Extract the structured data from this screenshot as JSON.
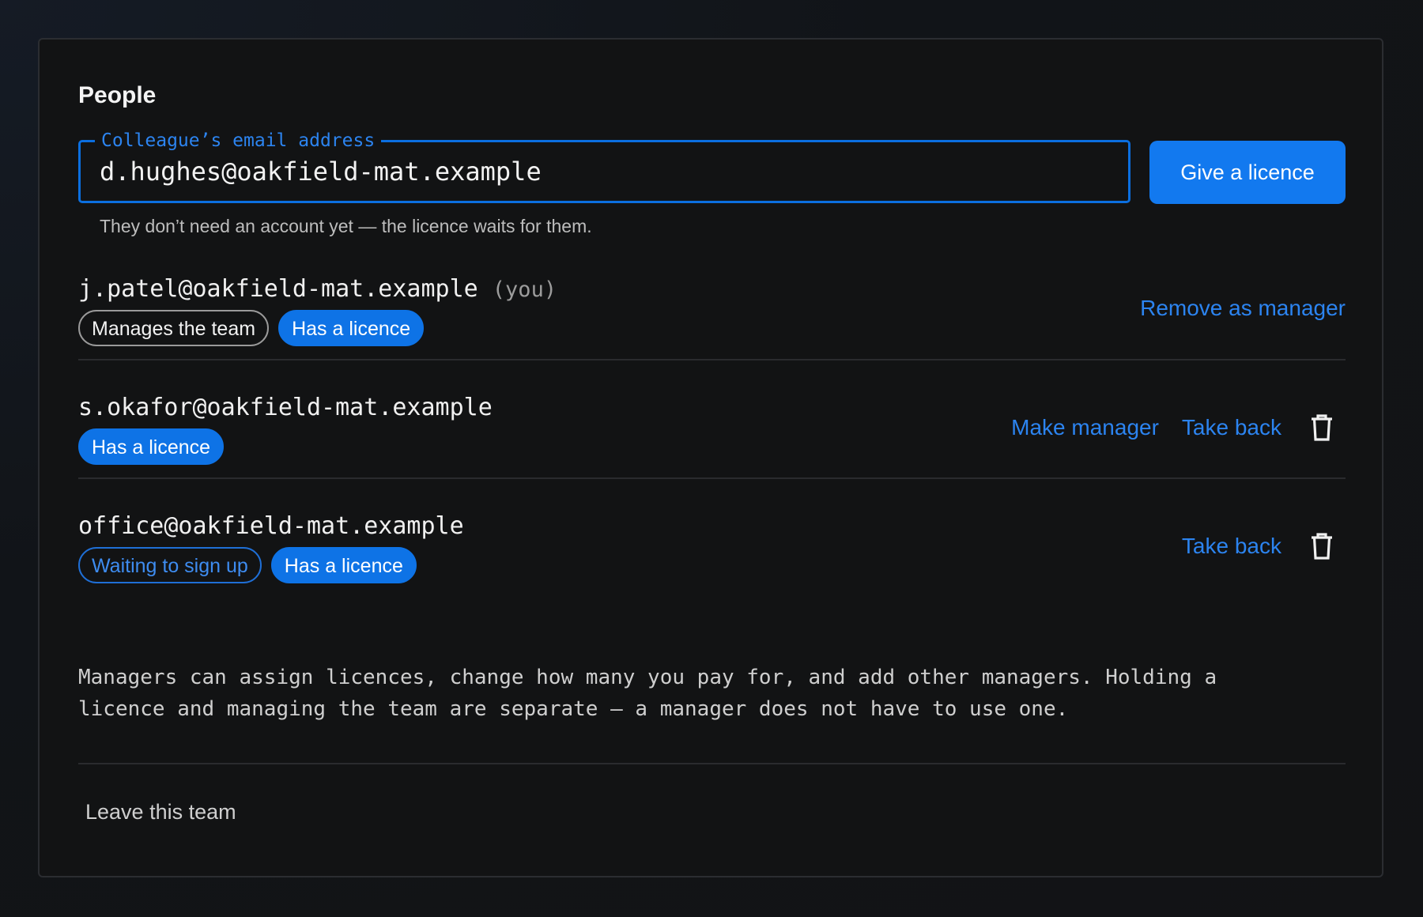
{
  "section_title": "People",
  "invite": {
    "field_label": "Colleague’s email address",
    "value": "d.hughes@oakfield-mat.example",
    "button_label": "Give a licence",
    "hint": "They don’t need an account yet — the licence waits for them."
  },
  "members": [
    {
      "email": "j.patel@oakfield-mat.example",
      "you_label": "(you)",
      "badges": [
        "Manages the team",
        "Has a licence"
      ],
      "actions": [
        "Remove as manager"
      ]
    },
    {
      "email": "s.okafor@oakfield-mat.example",
      "badges": [
        "Has a licence"
      ],
      "actions": [
        "Make manager",
        "Take back"
      ],
      "delete_icon": "trash-icon"
    },
    {
      "email": "office@oakfield-mat.example",
      "badges": [
        "Waiting to sign up",
        "Has a licence"
      ],
      "actions": [
        "Take back"
      ],
      "delete_icon": "trash-icon"
    }
  ],
  "note": "Managers can assign licences, change how many you pay for, and add other managers. Holding a licence and managing the team are separate — a manager does not have to use one.",
  "leave_label": "Leave this team",
  "colors": {
    "accent": "#1279ef",
    "link": "#2c84f0",
    "background": "#121314"
  }
}
